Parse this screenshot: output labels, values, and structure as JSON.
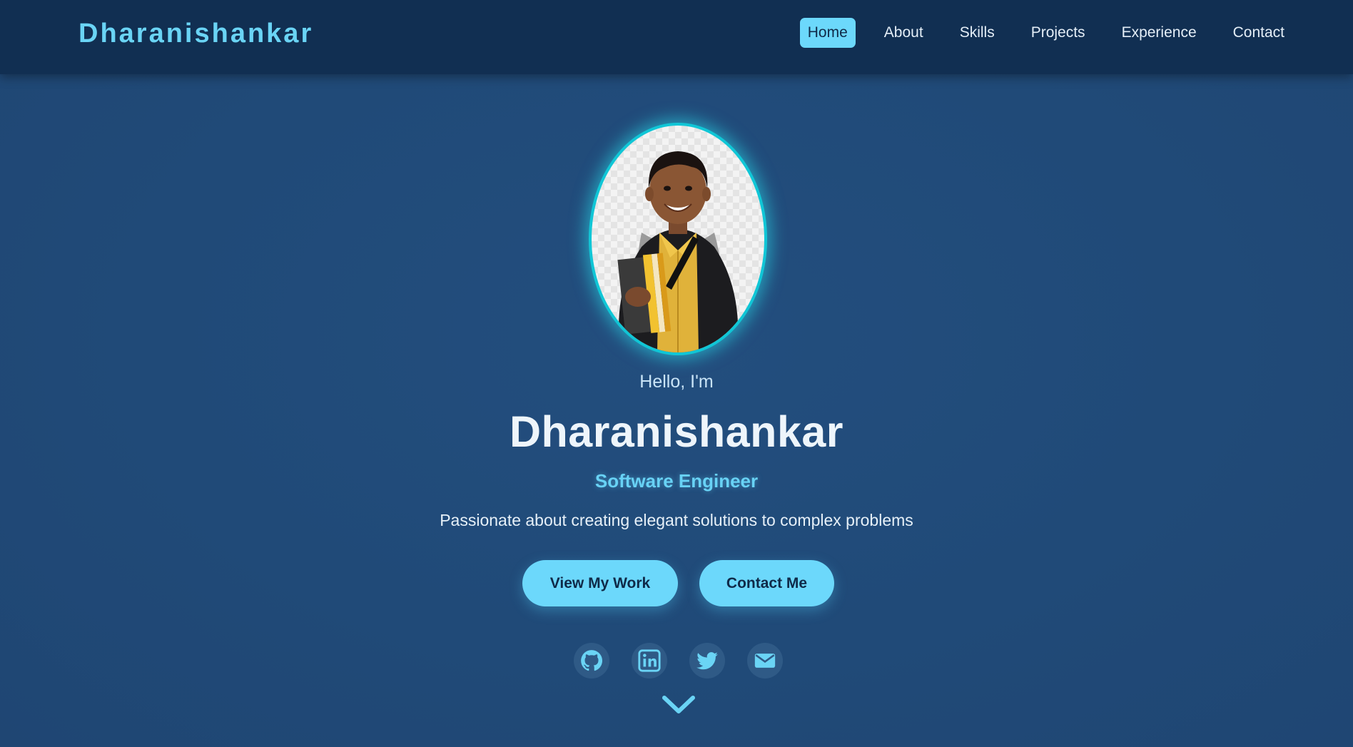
{
  "header": {
    "brand": "Dharanishankar",
    "nav": [
      {
        "label": "Home",
        "active": true
      },
      {
        "label": "About",
        "active": false
      },
      {
        "label": "Skills",
        "active": false
      },
      {
        "label": "Projects",
        "active": false
      },
      {
        "label": "Experience",
        "active": false
      },
      {
        "label": "Contact",
        "active": false
      }
    ]
  },
  "hero": {
    "greeting": "Hello, I'm",
    "name": "Dharanishankar",
    "role": "Software Engineer",
    "tagline": "Passionate about creating elegant solutions to complex problems",
    "buttons": {
      "primary": "View My Work",
      "secondary": "Contact Me"
    },
    "social_icons": [
      "github-icon",
      "linkedin-icon",
      "twitter-icon",
      "email-icon"
    ],
    "scroll_icon": "chevron-down-icon"
  },
  "colors": {
    "accent": "#6cd8fb",
    "navbar": "#112f52",
    "background": "#214b7a",
    "avatar_ring": "#10c6d6"
  }
}
